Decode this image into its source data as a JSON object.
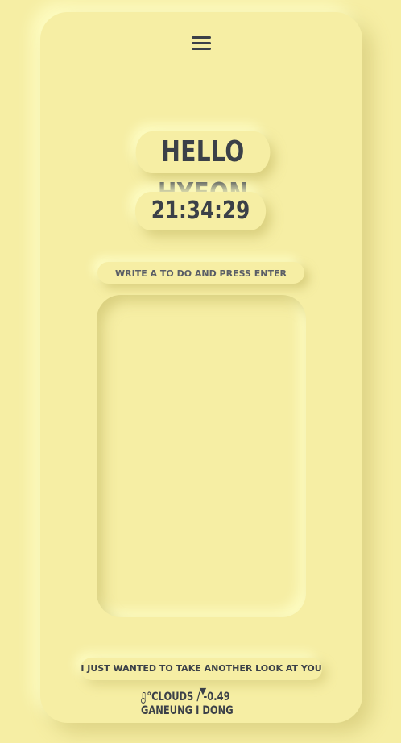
{
  "greeting": "HELLO HYEON",
  "clock": "21:34:29",
  "todo": {
    "placeholder": "WRITE A TO DO AND PRESS ENTER",
    "value": "",
    "items": []
  },
  "quote": {
    "text": "I JUST WANTED TO TAKE ANOTHER LOOK AT YOU",
    "toggle_icon": "triangle-down-icon"
  },
  "weather": {
    "icon": "thermometer-icon",
    "summary": "°CLOUDS / -0.49",
    "location": "GANEUNG I DONG"
  },
  "colors": {
    "background": "#f6eea4",
    "text": "#3b4048"
  }
}
